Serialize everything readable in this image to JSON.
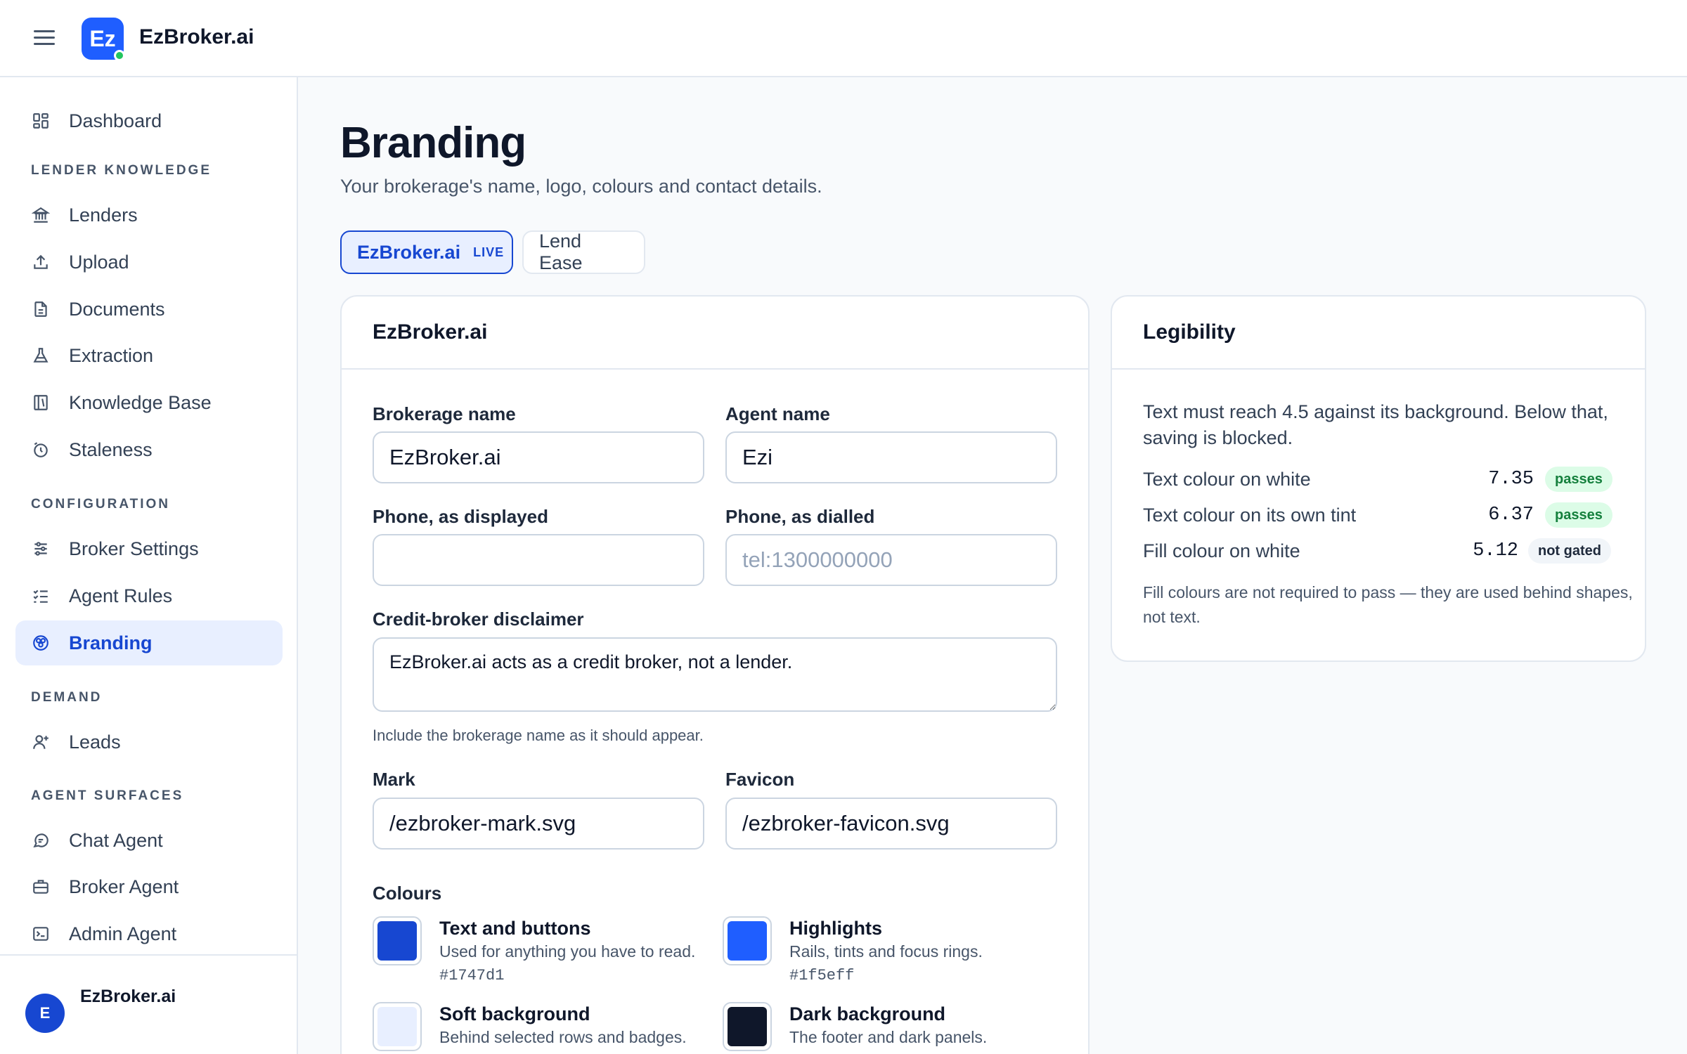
{
  "app": {
    "name": "EzBroker.ai",
    "logo_text": "Ez"
  },
  "sidebar": {
    "items": [
      {
        "label": "Dashboard",
        "icon": "dashboard-icon"
      },
      {
        "label": "Lenders",
        "icon": "bank-icon"
      },
      {
        "label": "Upload",
        "icon": "upload-icon"
      },
      {
        "label": "Documents",
        "icon": "document-icon"
      },
      {
        "label": "Extraction",
        "icon": "flask-icon"
      },
      {
        "label": "Knowledge Base",
        "icon": "book-icon"
      },
      {
        "label": "Staleness",
        "icon": "clock-icon"
      },
      {
        "label": "Broker Settings",
        "icon": "sliders-icon"
      },
      {
        "label": "Agent Rules",
        "icon": "checklist-icon"
      },
      {
        "label": "Branding",
        "icon": "palette-icon",
        "active": true
      },
      {
        "label": "Leads",
        "icon": "user-plus-icon"
      },
      {
        "label": "Chat Agent",
        "icon": "chat-icon"
      },
      {
        "label": "Broker Agent",
        "icon": "briefcase-icon"
      },
      {
        "label": "Admin Agent",
        "icon": "terminal-icon"
      }
    ],
    "sections": {
      "lender_knowledge": "LENDER KNOWLEDGE",
      "configuration": "CONFIGURATION",
      "demand": "DEMAND",
      "agent_surfaces": "AGENT SURFACES"
    },
    "footer": {
      "avatar_initial": "E",
      "name": "EzBroker.ai"
    }
  },
  "page": {
    "title": "Branding",
    "subtitle": "Your brokerage's name, logo, colours and contact details."
  },
  "tabs": [
    {
      "label": "EzBroker.ai",
      "badge": "LIVE",
      "active": true
    },
    {
      "label": "Lend Ease",
      "active": false
    }
  ],
  "form": {
    "card_title": "EzBroker.ai",
    "brokerage_name": {
      "label": "Brokerage name",
      "value": "EzBroker.ai"
    },
    "agent_name": {
      "label": "Agent name",
      "value": "Ezi"
    },
    "phone_displayed": {
      "label": "Phone, as displayed",
      "value": ""
    },
    "phone_dialled": {
      "label": "Phone, as dialled",
      "value": "",
      "placeholder": "tel:1300000000"
    },
    "disclaimer": {
      "label": "Credit-broker disclaimer",
      "value": "EzBroker.ai acts as a credit broker, not a lender.",
      "help": "Include the brokerage name as it should appear."
    },
    "mark": {
      "label": "Mark",
      "value": "/ezbroker-mark.svg"
    },
    "favicon": {
      "label": "Favicon",
      "value": "/ezbroker-favicon.svg"
    },
    "colours_label": "Colours",
    "colours": [
      {
        "title": "Text and buttons",
        "desc": "Used for anything you have to read.",
        "hex": "#1747d1",
        "color": "#1747d1"
      },
      {
        "title": "Highlights",
        "desc": "Rails, tints and focus rings.",
        "hex": "#1f5eff",
        "color": "#1f5eff"
      },
      {
        "title": "Soft background",
        "desc": "Behind selected rows and badges.",
        "color": "#e8efff"
      },
      {
        "title": "Dark background",
        "desc": "The footer and dark panels.",
        "color": "#0f172a"
      }
    ]
  },
  "legibility": {
    "title": "Legibility",
    "intro": "Text must reach 4.5 against its background. Below that, saving is blocked.",
    "rows": [
      {
        "label": "Text colour on white",
        "ratio": "7.35",
        "status": "passes"
      },
      {
        "label": "Text colour on its own tint",
        "ratio": "6.37",
        "status": "passes"
      },
      {
        "label": "Fill colour on white",
        "ratio": "5.12",
        "status": "not gated"
      }
    ],
    "note": "Fill colours are not required to pass — they are used behind shapes, not text."
  }
}
